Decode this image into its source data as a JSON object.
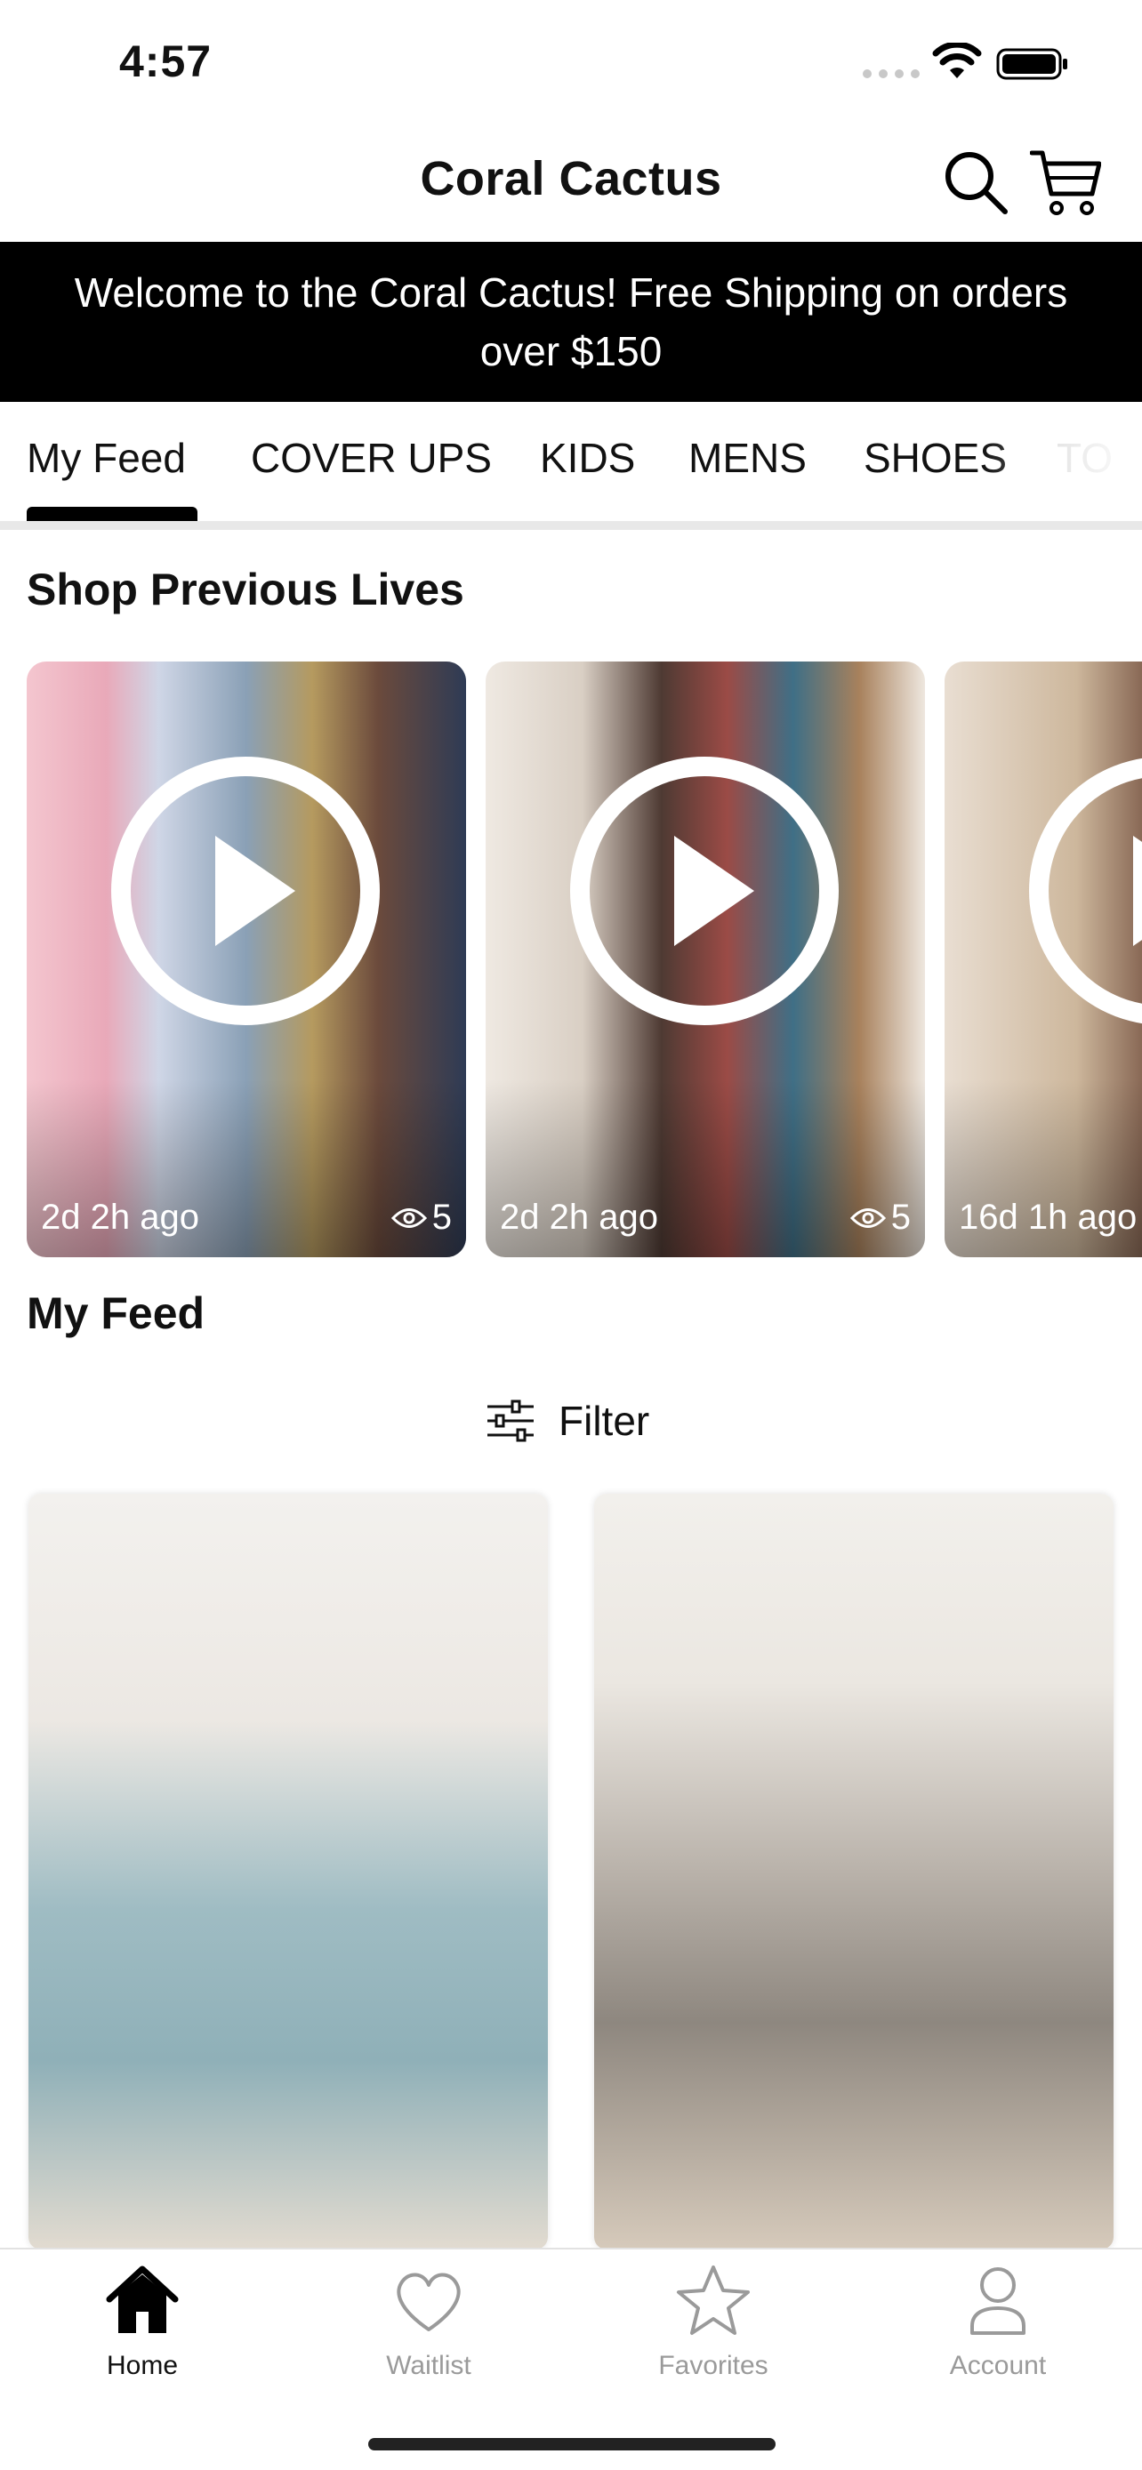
{
  "status_bar": {
    "time": "4:57"
  },
  "header": {
    "title": "Coral Cactus"
  },
  "banner": {
    "text": "Welcome to the Coral Cactus! Free Shipping on orders over $150"
  },
  "tabs": {
    "items": [
      {
        "label": "My Feed",
        "active": true
      },
      {
        "label": "COVER UPS",
        "active": false
      },
      {
        "label": "KIDS",
        "active": false
      },
      {
        "label": "MENS",
        "active": false
      },
      {
        "label": "SHOES",
        "active": false
      },
      {
        "label": "TO",
        "active": false
      }
    ]
  },
  "previous_lives": {
    "title": "Shop Previous Lives",
    "items": [
      {
        "ago": "2d 2h ago",
        "views": "5",
        "icon": "play-icon"
      },
      {
        "ago": "2d 2h ago",
        "views": "5",
        "icon": "play-icon"
      },
      {
        "ago": "16d 1h ago",
        "views": "",
        "icon": "play-icon"
      }
    ]
  },
  "feed": {
    "title": "My Feed",
    "filter_label": "Filter"
  },
  "bottom_nav": {
    "items": [
      {
        "label": "Home",
        "icon": "home-icon",
        "active": true
      },
      {
        "label": "Waitlist",
        "icon": "heart-icon",
        "active": false
      },
      {
        "label": "Favorites",
        "icon": "star-icon",
        "active": false
      },
      {
        "label": "Account",
        "icon": "person-icon",
        "active": false
      }
    ]
  },
  "colors": {
    "banner_bg": "#000000",
    "inactive_nav": "#9a9a9a",
    "accent": "#000000"
  }
}
